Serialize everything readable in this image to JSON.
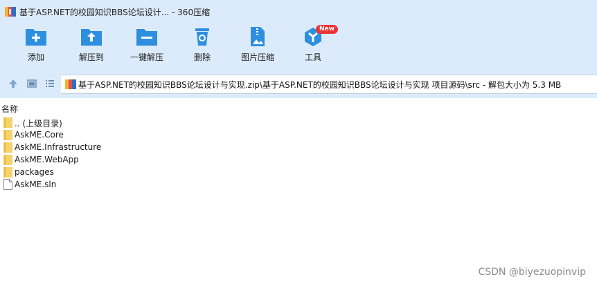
{
  "window": {
    "title": "基于ASP.NET的校园知识BBS论坛设计... - 360压缩",
    "app_icon": "archive-icon"
  },
  "toolbar": {
    "buttons": [
      {
        "label": "添加",
        "icon": "add-icon"
      },
      {
        "label": "解压到",
        "icon": "extract-to-icon"
      },
      {
        "label": "一键解压",
        "icon": "one-click-extract-icon"
      },
      {
        "label": "删除",
        "icon": "trash-icon"
      },
      {
        "label": "图片压缩",
        "icon": "image-compress-icon"
      },
      {
        "label": "工具",
        "icon": "tools-icon",
        "badge": "New"
      }
    ]
  },
  "navbar": {
    "path": "基于ASP.NET的校园知识BBS论坛设计与实现.zip\\基于ASP.NET的校园知识BBS论坛设计与实现 项目源码\\src - 解包大小为 5.3 MB"
  },
  "list": {
    "column_name": "名称",
    "items": [
      {
        "name": ".. (上级目录)",
        "type": "parent"
      },
      {
        "name": "AskME.Core",
        "type": "folder"
      },
      {
        "name": "AskME.Infrastructure",
        "type": "folder"
      },
      {
        "name": "AskME.WebApp",
        "type": "folder"
      },
      {
        "name": "packages",
        "type": "folder"
      },
      {
        "name": "AskME.sln",
        "type": "file"
      }
    ]
  },
  "watermark": "CSDN @biyezuopinvip",
  "colors": {
    "chrome": "#dcebfb",
    "icon_blue": "#2e8fe0",
    "folder": "#f6d36b",
    "badge": "#e8353a"
  }
}
